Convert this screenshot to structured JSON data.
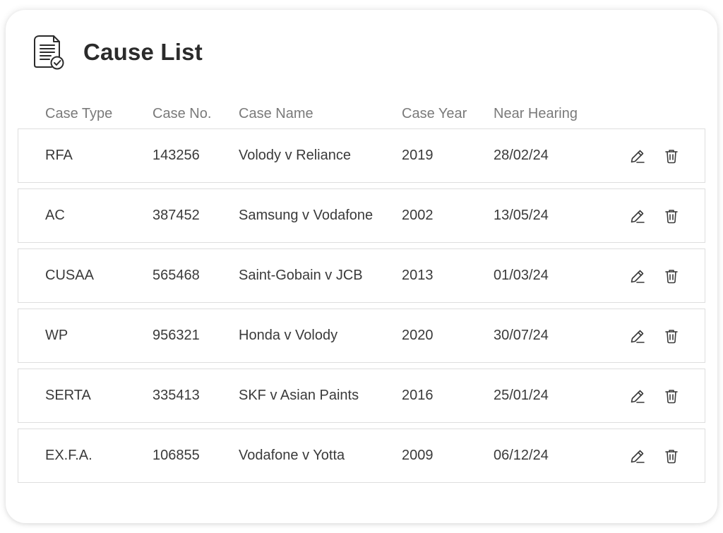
{
  "header": {
    "title": "Cause List",
    "icon": "document-check-icon"
  },
  "table": {
    "columns": [
      "Case Type",
      "Case No.",
      "Case Name",
      "Case Year",
      "Near Hearing"
    ],
    "rows": [
      {
        "type": "RFA",
        "number": "143256",
        "name": "Volody v Reliance",
        "year": "2019",
        "hearing": "28/02/24"
      },
      {
        "type": "AC",
        "number": "387452",
        "name": "Samsung v Vodafone",
        "year": "2002",
        "hearing": "13/05/24"
      },
      {
        "type": "CUSAA",
        "number": "565468",
        "name": "Saint-Gobain v JCB",
        "year": "2013",
        "hearing": "01/03/24"
      },
      {
        "type": "WP",
        "number": "956321",
        "name": "Honda v Volody",
        "year": "2020",
        "hearing": "30/07/24"
      },
      {
        "type": "SERTA",
        "number": "335413",
        "name": "SKF v Asian Paints",
        "year": "2016",
        "hearing": "25/01/24"
      },
      {
        "type": "EX.F.A.",
        "number": "106855",
        "name": "Vodafone v Yotta",
        "year": "2009",
        "hearing": "06/12/24"
      }
    ],
    "row_actions": [
      "edit-icon",
      "delete-icon"
    ]
  },
  "colors": {
    "text": "#2b2b2b",
    "header_text": "#7a7a7a",
    "row_border": "#dedede",
    "icon": "#3a3a3a"
  }
}
